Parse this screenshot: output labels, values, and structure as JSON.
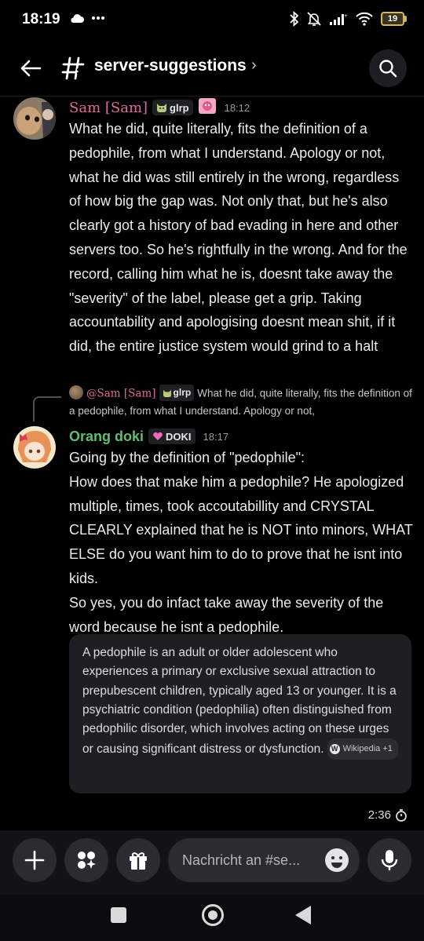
{
  "status": {
    "time": "18:19",
    "battery": "19",
    "left_icons": [
      "cloud-icon",
      "more-dots-icon"
    ],
    "right_icons": [
      "bluetooth-icon",
      "bell-muted-icon",
      "signal-icon",
      "wifi-icon",
      "battery-icon"
    ]
  },
  "header": {
    "channel": "server-suggestions",
    "chevron": "›"
  },
  "messages": [
    {
      "author": "Sam [Sam]",
      "tag": "glrp",
      "time": "18:12",
      "color": "#e06a9e",
      "text": "What he did, quite literally, fits the definition of a pedophile, from what I understand. Apology or not, what he did was still entirely in the wrong, regardless of how big the gap was. Not only that, but he's also clearly got a history of bad evading in here and other servers too. So he's rightfully in the wrong. And for the record, calling him what he is, doesnt take away the \"severity\" of the label, please get a grip. Taking accountability and apologising doesnt mean shit, if it did, the entire justice system would grind to a halt"
    },
    {
      "reply": {
        "author": "@Sam [Sam]",
        "tag": "glrp",
        "text": "What he did, quite literally, fits the definition of a pedophile, from what I understand. Apology or not,"
      },
      "author": "Orang doki",
      "tag": "DOKI",
      "time": "18:17",
      "color": "#5fbf73",
      "text": "Going by the definition of \"pedophile\":\nHow does that make him a pedophile? He apologized multiple, times, took accoutabillity and CRYSTAL CLEARLY explained that he is NOT into minors, WHAT ELSE do you want him to do to prove that he isnt into kids.\nSo yes, you do infact take away the severity of the word because he isnt a pedophile.",
      "embed": {
        "text": "A pedophile is an adult or older adolescent who experiences a primary or exclusive sexual attraction to prepubescent children, typically aged 13 or younger. It is a psychiatric condition (pedophilia) often distinguished from pedophilic disorder, which involves acting on these urges or causing significant distress or dysfunction.",
        "source": "Wikipedia +1",
        "source_icon": "W"
      }
    }
  ],
  "timer": "2:36",
  "composer": {
    "placeholder": "Nachricht an #se..."
  }
}
